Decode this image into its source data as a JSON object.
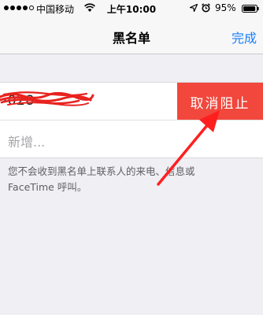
{
  "status_bar": {
    "carrier": "中国移动",
    "time": "上午10:00",
    "battery_percent": "95%",
    "battery_level": 0.95,
    "icons": [
      "signal-dots-icon",
      "wifi-icon",
      "location-arrow-icon",
      "alarm-icon",
      "battery-icon"
    ]
  },
  "nav": {
    "title": "黑名单",
    "done_label": "完成"
  },
  "blocked_list": {
    "number_partial": "···028",
    "unblock_label": "取消阻止",
    "add_new_label": "新增..."
  },
  "footer": {
    "note": "您不会收到黑名单上联系人的来电、信息或 FaceTime 呼叫。"
  },
  "colors": {
    "accent_blue": "#1a7ffc",
    "destructive_red": "#f1473c",
    "background": "#efeff4",
    "annotation_red": "#ff1f1f"
  }
}
